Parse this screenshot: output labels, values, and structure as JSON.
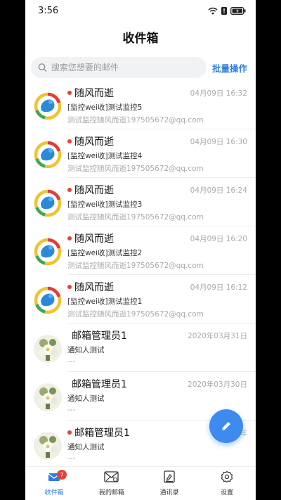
{
  "status_bar": {
    "time": "3:56"
  },
  "header": {
    "title": "收件箱"
  },
  "search": {
    "placeholder": "搜索您想要的邮件",
    "batch_label": "批量操作"
  },
  "emails": [
    {
      "sender": "随风而逝",
      "time": "04月09日 16:32",
      "subject": "[监控wei收]测试监控5",
      "preview": "测试监控随风而逝197505672@qq.com",
      "unread": true,
      "avatar": "weibo-avatar"
    },
    {
      "sender": "随风而逝",
      "time": "04月09日 16:30",
      "subject": "[监控wei收]测试监控4",
      "preview": "测试监控随风而逝197505672@qq.com",
      "unread": true,
      "avatar": "weibo-avatar"
    },
    {
      "sender": "随风而逝",
      "time": "04月09日 16:24",
      "subject": "[监控wei收]测试监控3",
      "preview": "测试监控随风而逝197505672@qq.com",
      "unread": true,
      "avatar": "weibo-avatar"
    },
    {
      "sender": "随风而逝",
      "time": "04月09日 16:20",
      "subject": "[监控wei收]测试监控2",
      "preview": "测试监控随风而逝197505672@qq.com",
      "unread": true,
      "avatar": "weibo-avatar"
    },
    {
      "sender": "随风而逝",
      "time": "04月09日 16:12",
      "subject": "[监控wei收]测试监控1",
      "preview": "测试监控随风而逝197505672@qq.com",
      "unread": true,
      "avatar": "weibo-avatar"
    },
    {
      "sender": "邮箱管理员1",
      "time": "2020年03月31日",
      "subject": "通知人测试",
      "preview": "---",
      "unread": false,
      "avatar": "flower-avatar"
    },
    {
      "sender": "邮箱管理员1",
      "time": "2020年03月30日",
      "subject": "通知人测试",
      "preview": "---",
      "unread": false,
      "avatar": "flower-avatar"
    },
    {
      "sender": "邮箱管理员1",
      "time": "2020年",
      "subject": "通知人测试",
      "preview": "---",
      "unread": true,
      "avatar": "flower-avatar"
    }
  ],
  "tabs": [
    {
      "label": "收件箱",
      "icon": "inbox-icon",
      "badge": "7",
      "active": true
    },
    {
      "label": "我的邮箱",
      "icon": "mailbox-icon",
      "active": false
    },
    {
      "label": "通讯录",
      "icon": "contacts-icon",
      "active": false
    },
    {
      "label": "设置",
      "icon": "gear-icon",
      "active": false
    }
  ],
  "colors": {
    "accent": "#2e7de1",
    "unread": "#e8413a",
    "fab": "#3d8bef"
  }
}
